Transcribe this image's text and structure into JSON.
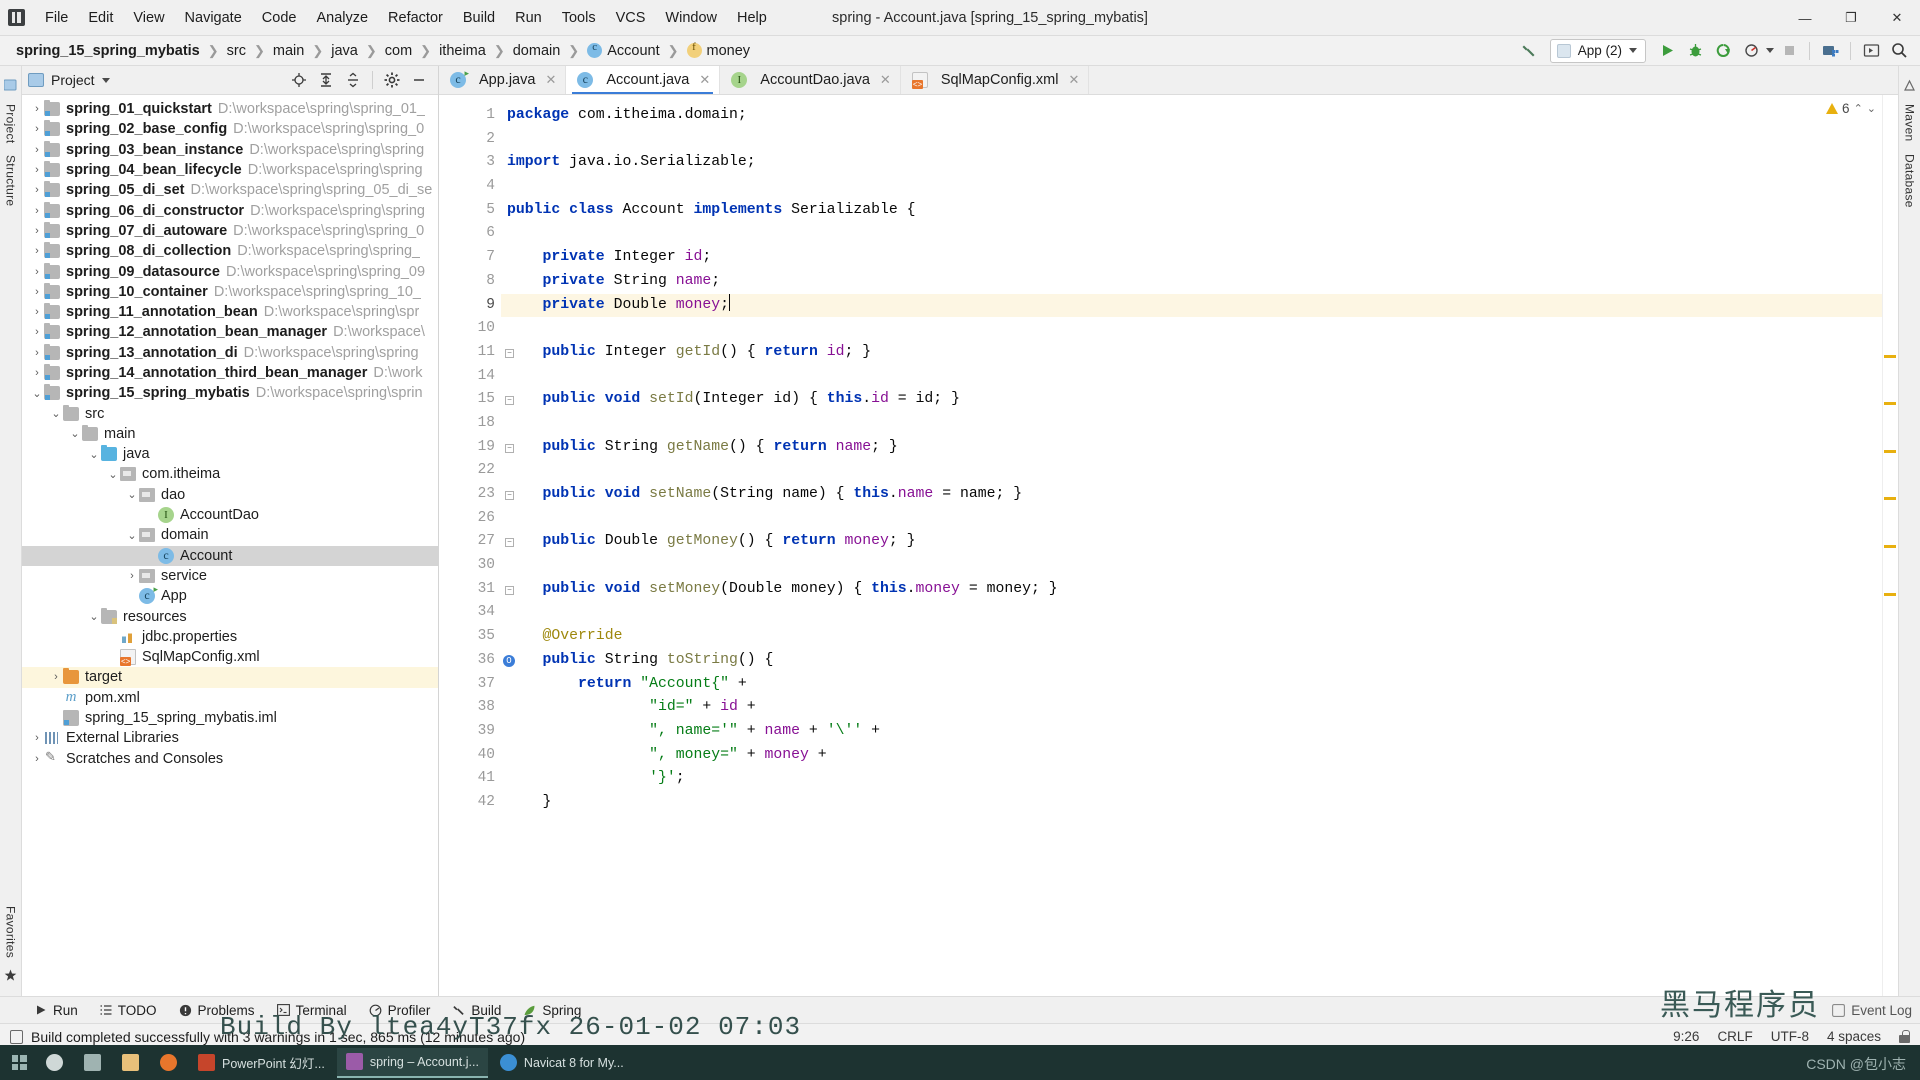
{
  "window": {
    "title": "spring - Account.java [spring_15_spring_mybatis]",
    "app_icon": "intellij-idea-icon",
    "minimize": "—",
    "maximize": "❐",
    "close": "✕"
  },
  "menu": [
    "File",
    "Edit",
    "View",
    "Navigate",
    "Code",
    "Analyze",
    "Refactor",
    "Build",
    "Run",
    "Tools",
    "VCS",
    "Window",
    "Help"
  ],
  "breadcrumb": [
    {
      "label": "spring_15_spring_mybatis",
      "icon": null,
      "bold": true
    },
    {
      "label": "src",
      "icon": null,
      "bold": false
    },
    {
      "label": "main",
      "icon": null,
      "bold": false
    },
    {
      "label": "java",
      "icon": null,
      "bold": false
    },
    {
      "label": "com",
      "icon": null,
      "bold": false
    },
    {
      "label": "itheima",
      "icon": null,
      "bold": false
    },
    {
      "label": "domain",
      "icon": null,
      "bold": false
    },
    {
      "label": "Account",
      "icon": "class-icon",
      "bold": false
    },
    {
      "label": "money",
      "icon": "field-icon",
      "bold": false
    }
  ],
  "toolbar": {
    "build_icon": "hammer-icon",
    "run_config": "App (2)",
    "run_icon": "run-icon",
    "debug_icon": "debug-bug-icon",
    "coverage_icon": "run-with-coverage-icon",
    "profiler_icon": "profiler-icon",
    "stop_icon": "stop-icon",
    "git_icon": "vcs-icon",
    "layout_icon": "layout-icon",
    "search_icon": "search-everywhere-icon"
  },
  "project_panel": {
    "title": "Project",
    "icons": [
      "locate-icon",
      "expand-all-icon",
      "collapse-all-icon",
      "settings-gear-icon",
      "hide-icon"
    ],
    "tree": [
      {
        "indent": 0,
        "arrow": "›",
        "icon": "fi-mod",
        "name": "spring_01_quickstart",
        "path": "D:\\workspace\\spring\\spring_01_",
        "bold": true
      },
      {
        "indent": 0,
        "arrow": "›",
        "icon": "fi-mod",
        "name": "spring_02_base_config",
        "path": "D:\\workspace\\spring\\spring_0",
        "bold": true
      },
      {
        "indent": 0,
        "arrow": "›",
        "icon": "fi-mod",
        "name": "spring_03_bean_instance",
        "path": "D:\\workspace\\spring\\spring",
        "bold": true
      },
      {
        "indent": 0,
        "arrow": "›",
        "icon": "fi-mod",
        "name": "spring_04_bean_lifecycle",
        "path": "D:\\workspace\\spring\\spring",
        "bold": true
      },
      {
        "indent": 0,
        "arrow": "›",
        "icon": "fi-mod",
        "name": "spring_05_di_set",
        "path": "D:\\workspace\\spring\\spring_05_di_se",
        "bold": true
      },
      {
        "indent": 0,
        "arrow": "›",
        "icon": "fi-mod",
        "name": "spring_06_di_constructor",
        "path": "D:\\workspace\\spring\\spring",
        "bold": true
      },
      {
        "indent": 0,
        "arrow": "›",
        "icon": "fi-mod",
        "name": "spring_07_di_autoware",
        "path": "D:\\workspace\\spring\\spring_0",
        "bold": true
      },
      {
        "indent": 0,
        "arrow": "›",
        "icon": "fi-mod",
        "name": "spring_08_di_collection",
        "path": "D:\\workspace\\spring\\spring_",
        "bold": true
      },
      {
        "indent": 0,
        "arrow": "›",
        "icon": "fi-mod",
        "name": "spring_09_datasource",
        "path": "D:\\workspace\\spring\\spring_09",
        "bold": true
      },
      {
        "indent": 0,
        "arrow": "›",
        "icon": "fi-mod",
        "name": "spring_10_container",
        "path": "D:\\workspace\\spring\\spring_10_",
        "bold": true
      },
      {
        "indent": 0,
        "arrow": "›",
        "icon": "fi-mod",
        "name": "spring_11_annotation_bean",
        "path": "D:\\workspace\\spring\\spr",
        "bold": true
      },
      {
        "indent": 0,
        "arrow": "›",
        "icon": "fi-mod",
        "name": "spring_12_annotation_bean_manager",
        "path": "D:\\workspace\\",
        "bold": true
      },
      {
        "indent": 0,
        "arrow": "›",
        "icon": "fi-mod",
        "name": "spring_13_annotation_di",
        "path": "D:\\workspace\\spring\\spring",
        "bold": true
      },
      {
        "indent": 0,
        "arrow": "›",
        "icon": "fi-mod",
        "name": "spring_14_annotation_third_bean_manager",
        "path": "D:\\work",
        "bold": true
      },
      {
        "indent": 0,
        "arrow": "⌄",
        "icon": "fi-mod",
        "name": "spring_15_spring_mybatis",
        "path": "D:\\workspace\\spring\\sprin",
        "bold": true
      },
      {
        "indent": 1,
        "arrow": "⌄",
        "icon": "fi-grey",
        "name": "src",
        "path": "",
        "bold": false
      },
      {
        "indent": 2,
        "arrow": "⌄",
        "icon": "fi-grey",
        "name": "main",
        "path": "",
        "bold": false
      },
      {
        "indent": 3,
        "arrow": "⌄",
        "icon": "fi-src",
        "name": "java",
        "path": "",
        "bold": false
      },
      {
        "indent": 4,
        "arrow": "⌄",
        "icon": "fi-pkg",
        "name": "com.itheima",
        "path": "",
        "bold": false
      },
      {
        "indent": 5,
        "arrow": "⌄",
        "icon": "fi-pkg",
        "name": "dao",
        "path": "",
        "bold": false
      },
      {
        "indent": 6,
        "arrow": "",
        "icon": "ficon-iface",
        "name": "AccountDao",
        "path": "",
        "bold": false
      },
      {
        "indent": 5,
        "arrow": "⌄",
        "icon": "fi-pkg",
        "name": "domain",
        "path": "",
        "bold": false
      },
      {
        "indent": 6,
        "arrow": "",
        "icon": "ficon-class",
        "name": "Account",
        "path": "",
        "bold": false,
        "selected": true
      },
      {
        "indent": 5,
        "arrow": "›",
        "icon": "fi-pkg",
        "name": "service",
        "path": "",
        "bold": false
      },
      {
        "indent": 5,
        "arrow": "",
        "icon": "ficon-app",
        "name": "App",
        "path": "",
        "bold": false
      },
      {
        "indent": 3,
        "arrow": "⌄",
        "icon": "fi-res",
        "name": "resources",
        "path": "",
        "bold": false
      },
      {
        "indent": 4,
        "arrow": "",
        "icon": "ficon-prop",
        "name": "jdbc.properties",
        "path": "",
        "bold": false
      },
      {
        "indent": 4,
        "arrow": "",
        "icon": "ficon-xml",
        "name": "SqlMapConfig.xml",
        "path": "",
        "bold": false
      },
      {
        "indent": 1,
        "arrow": "›",
        "icon": "fi-target",
        "name": "target",
        "path": "",
        "bold": false,
        "highlight": true
      },
      {
        "indent": 1,
        "arrow": "",
        "icon": "ficon-pom",
        "name": "pom.xml",
        "path": "",
        "bold": false
      },
      {
        "indent": 1,
        "arrow": "",
        "icon": "ficon-iml",
        "name": "spring_15_spring_mybatis.iml",
        "path": "",
        "bold": false
      },
      {
        "indent": 0,
        "arrow": "›",
        "icon": "fi-lib",
        "name": "External Libraries",
        "path": "",
        "bold": false
      },
      {
        "indent": 0,
        "arrow": "›",
        "icon": "fi-scratch",
        "name": "Scratches and Consoles",
        "path": "",
        "bold": false
      }
    ]
  },
  "left_rail": {
    "labels": [
      "Project",
      "Structure"
    ],
    "bottom_label": "Favorites"
  },
  "right_rail": {
    "labels": [
      "Maven",
      "Database"
    ]
  },
  "editor": {
    "tabs": [
      {
        "label": "App.java",
        "icon": "java-class-runnable-icon",
        "active": false
      },
      {
        "label": "Account.java",
        "icon": "java-class-icon",
        "active": true
      },
      {
        "label": "AccountDao.java",
        "icon": "java-interface-icon",
        "active": false
      },
      {
        "label": "SqlMapConfig.xml",
        "icon": "xml-file-icon",
        "active": false
      }
    ],
    "warning_count": "6",
    "warning_icon": "warning-triangle-icon",
    "line_numbers": [
      "1",
      "2",
      "3",
      "4",
      "5",
      "6",
      "7",
      "8",
      "9",
      "10",
      "11",
      "14",
      "15",
      "18",
      "19",
      "22",
      "23",
      "26",
      "27",
      "30",
      "31",
      "34",
      "35",
      "36",
      "37",
      "38",
      "39",
      "40",
      "41",
      "42"
    ],
    "current_line": "9",
    "code_lines": [
      {
        "n": "1",
        "html": "<span class=\"kw\">package</span> com.itheima.domain;"
      },
      {
        "n": "2",
        "html": ""
      },
      {
        "n": "3",
        "html": "<span class=\"kw\">import</span> java.io.Serializable;"
      },
      {
        "n": "4",
        "html": ""
      },
      {
        "n": "5",
        "html": "<span class=\"kw\">public class</span> Account <span class=\"kw\">implements</span> Serializable {"
      },
      {
        "n": "6",
        "html": ""
      },
      {
        "n": "7",
        "html": "    <span class=\"kw\">private</span> Integer <span class=\"fd\">id</span>;"
      },
      {
        "n": "8",
        "html": "    <span class=\"kw\">private</span> String <span class=\"fd\">name</span>;"
      },
      {
        "n": "9",
        "html": "    <span class=\"kw\">private</span> Double <span class=\"fd\">money</span>;",
        "highlight": true,
        "caret": true
      },
      {
        "n": "10",
        "html": ""
      },
      {
        "n": "11",
        "html": "    <span class=\"kw\">public</span> Integer <span class=\"mth\">getId</span>() { <span class=\"kw\">return</span> <span class=\"fd\">id</span>; }",
        "fold": true
      },
      {
        "n": "14",
        "html": ""
      },
      {
        "n": "15",
        "html": "    <span class=\"kw\">public void</span> <span class=\"mth\">setId</span>(Integer id) { <span class=\"kw\">this</span>.<span class=\"fd\">id</span> = id; }",
        "fold": true
      },
      {
        "n": "18",
        "html": ""
      },
      {
        "n": "19",
        "html": "    <span class=\"kw\">public</span> String <span class=\"mth\">getName</span>() { <span class=\"kw\">return</span> <span class=\"fd\">name</span>; }",
        "fold": true
      },
      {
        "n": "22",
        "html": ""
      },
      {
        "n": "23",
        "html": "    <span class=\"kw\">public void</span> <span class=\"mth\">setName</span>(String name) { <span class=\"kw\">this</span>.<span class=\"fd\">name</span> = name; }",
        "fold": true
      },
      {
        "n": "26",
        "html": ""
      },
      {
        "n": "27",
        "html": "    <span class=\"kw\">public</span> Double <span class=\"mth\">getMoney</span>() { <span class=\"kw\">return</span> <span class=\"fd\">money</span>; }",
        "fold": true
      },
      {
        "n": "30",
        "html": ""
      },
      {
        "n": "31",
        "html": "    <span class=\"kw\">public void</span> <span class=\"mth\">setMoney</span>(Double money) { <span class=\"kw\">this</span>.<span class=\"fd\">money</span> = money; }",
        "fold": true
      },
      {
        "n": "34",
        "html": ""
      },
      {
        "n": "35",
        "html": "    <span class=\"an\">@Override</span>"
      },
      {
        "n": "36",
        "html": "    <span class=\"kw\">public</span> String <span class=\"mth\">toString</span>() {",
        "override": true
      },
      {
        "n": "37",
        "html": "        <span class=\"kw\">return</span> <span class=\"st\">\"Account{\"</span> +"
      },
      {
        "n": "38",
        "html": "                <span class=\"st\">\"id=\"</span> + <span class=\"fd\">id</span> +"
      },
      {
        "n": "39",
        "html": "                <span class=\"st\">\", name='\"</span> + <span class=\"fd\">name</span> + <span class=\"st\">'\\''</span> +"
      },
      {
        "n": "40",
        "html": "                <span class=\"st\">\", money=\"</span> + <span class=\"fd\">money</span> +"
      },
      {
        "n": "41",
        "html": "                <span class=\"st\">'}'</span>;"
      },
      {
        "n": "42",
        "html": "    }"
      }
    ]
  },
  "tool_windows": [
    {
      "label": "Run",
      "icon": "run-icon"
    },
    {
      "label": "TODO",
      "icon": "todo-list-icon"
    },
    {
      "label": "Problems",
      "icon": "problems-icon"
    },
    {
      "label": "Terminal",
      "icon": "terminal-icon"
    },
    {
      "label": "Profiler",
      "icon": "profiler-icon"
    },
    {
      "label": "Build",
      "icon": "hammer-icon"
    },
    {
      "label": "Spring",
      "icon": "spring-leaf-icon"
    }
  ],
  "event_log": {
    "label": "Event Log",
    "icon": "event-log-icon"
  },
  "status": {
    "message": "Build completed successfully with 3 warnings in 1 sec, 865 ms (12 minutes ago)",
    "caret_position": "9:26",
    "line_separator": "CRLF",
    "encoding": "UTF-8",
    "indent": "4 spaces",
    "lock_icon": "read-only-lock-icon"
  },
  "taskbar": {
    "start_icon": "windows-start-icon",
    "items": [
      {
        "label": "",
        "icon": "search-icon",
        "color": "#cfd8d7"
      },
      {
        "label": "",
        "icon": "task-view-icon",
        "color": "#9fb3b1"
      },
      {
        "label": "",
        "icon": "file-explorer-icon",
        "color": "#e8c07a"
      },
      {
        "label": "",
        "icon": "firefox-icon",
        "color": "#e8762c"
      },
      {
        "label": "PowerPoint 幻灯...",
        "icon": "powerpoint-icon",
        "color": "#c6452b"
      },
      {
        "label": "spring – Account.j...",
        "icon": "intellij-idea-icon",
        "color": "#9b5ba8",
        "active": true
      },
      {
        "label": "Navicat 8 for My...",
        "icon": "navicat-icon",
        "color": "#3b8fd4"
      }
    ],
    "ghost_text": "Build By ltea4yT37fx  26-01-02 07:03",
    "watermark_cn": "黑马程序员",
    "credit": "CSDN @包小志"
  }
}
